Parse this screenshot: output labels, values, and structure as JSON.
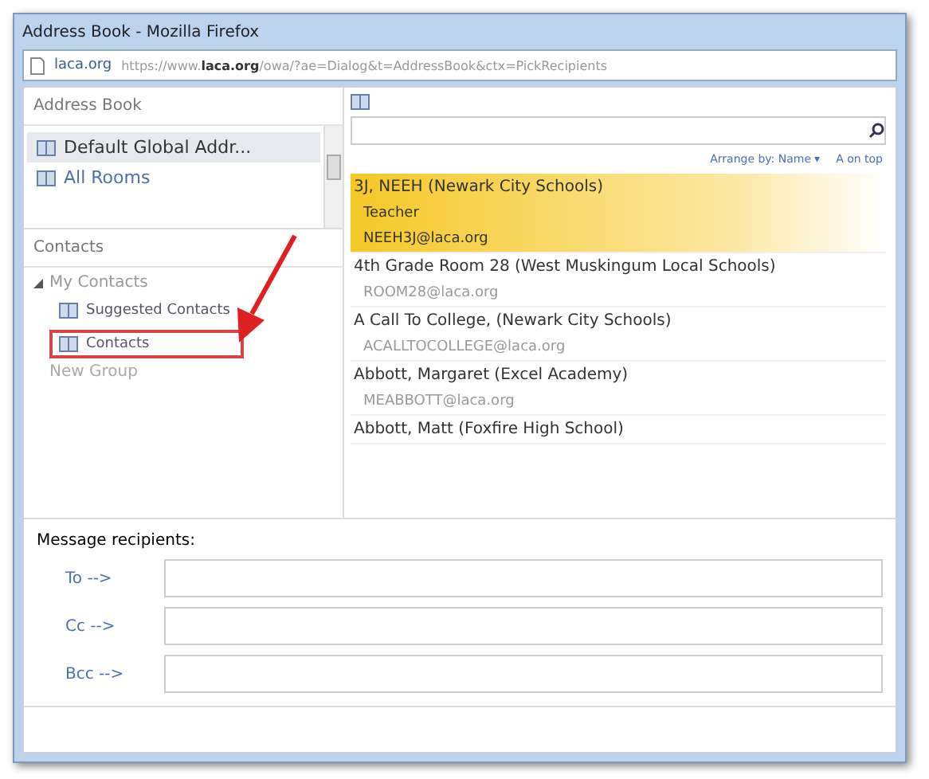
{
  "window": {
    "title": "Address Book - Mozilla Firefox"
  },
  "address_bar": {
    "site": "laca.org",
    "url": "https://www.**laca.org**/owa/?ae=Dialog&t=AddressBook&ctx=PickRecipients"
  },
  "address_book": {
    "title": "Address Book",
    "items": [
      {
        "label": "Default Global Addr...",
        "selected": true
      },
      {
        "label": "All Rooms",
        "selected": false
      }
    ]
  },
  "contacts": {
    "title": "Contacts",
    "tree": [
      {
        "label": "My Contacts",
        "expanded": true,
        "children": [
          {
            "label": "Suggested Contacts",
            "selected": false,
            "highlighted": false
          },
          {
            "label": "Contacts",
            "selected": false,
            "highlighted": true
          }
        ]
      }
    ],
    "new_group": "New Group"
  },
  "arrange": {
    "sort": "Arrange by: Name",
    "caret": "▾",
    "order": "A on top"
  },
  "entries": [
    {
      "name": "3J, NEEH (Newark City Schools)",
      "details": [
        "Teacher",
        "NEEH3J@laca.org"
      ],
      "selected": true
    },
    {
      "name": "4th Grade Room 28 (West Muskingum Local Schools)",
      "details": [
        "ROOM28@laca.org"
      ],
      "selected": false
    },
    {
      "name": "A Call To College, (Newark City Schools)",
      "details": [
        "ACALLTOCOLLEGE@laca.org"
      ],
      "selected": false
    },
    {
      "name": "Abbott, Margaret (Excel Academy)",
      "details": [
        "MEABBOTT@laca.org"
      ],
      "selected": false
    },
    {
      "name": "Abbott, Matt (Foxfire High School)",
      "selected": false
    }
  ],
  "recipients": {
    "title": "Message recipients:",
    "fields": [
      {
        "label": "To -->"
      },
      {
        "label": "Cc -->"
      },
      {
        "label": "Bcc -->"
      }
    ]
  }
}
